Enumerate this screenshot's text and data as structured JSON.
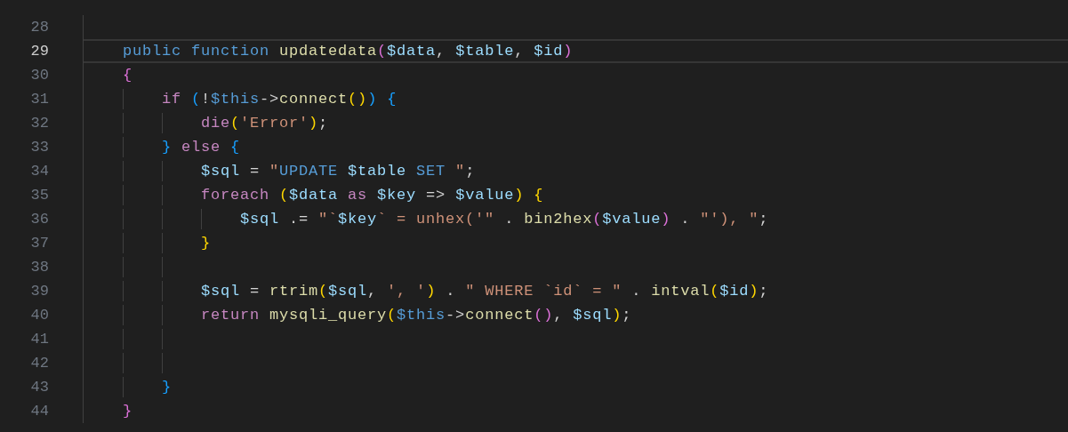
{
  "editor": {
    "lines": [
      {
        "number": "28",
        "selected": false
      },
      {
        "number": "29",
        "selected": true,
        "tokens": [
          {
            "text": "    public ",
            "kind": "kw"
          },
          {
            "text": "function ",
            "kind": "kw"
          },
          {
            "text": "updatedata",
            "kind": "fn"
          },
          {
            "text": "(",
            "kind": "b2"
          },
          {
            "text": "$data",
            "kind": "var"
          },
          {
            "text": ", ",
            "kind": "op"
          },
          {
            "text": "$table",
            "kind": "var"
          },
          {
            "text": ", ",
            "kind": "op"
          },
          {
            "text": "$id",
            "kind": "var"
          },
          {
            "text": ")",
            "kind": "b2"
          }
        ]
      },
      {
        "number": "30",
        "selected": false,
        "tokens": [
          {
            "text": "    {",
            "kind": "b2"
          }
        ]
      },
      {
        "number": "31",
        "selected": false,
        "tokens": [
          {
            "text": "        if ",
            "kind": "ctl"
          },
          {
            "text": "(",
            "kind": "b3"
          },
          {
            "text": "!",
            "kind": "op"
          },
          {
            "text": "$this",
            "kind": "this"
          },
          {
            "text": "->",
            "kind": "op"
          },
          {
            "text": "connect",
            "kind": "fn"
          },
          {
            "text": "()",
            "kind": "b1"
          },
          {
            "text": ") {",
            "kind": "b3"
          }
        ]
      },
      {
        "number": "32",
        "selected": false,
        "tokens": [
          {
            "text": "            die",
            "kind": "ctl"
          },
          {
            "text": "(",
            "kind": "b1"
          },
          {
            "text": "'Error'",
            "kind": "str"
          },
          {
            "text": ")",
            "kind": "b1"
          },
          {
            "text": ";",
            "kind": "op"
          }
        ]
      },
      {
        "number": "33",
        "selected": false,
        "tokens": [
          {
            "text": "        } ",
            "kind": "b3"
          },
          {
            "text": "else ",
            "kind": "ctl"
          },
          {
            "text": "{",
            "kind": "b3"
          }
        ]
      },
      {
        "number": "34",
        "selected": false,
        "tokens": [
          {
            "text": "            $sql",
            "kind": "var"
          },
          {
            "text": " = ",
            "kind": "op"
          },
          {
            "text": "\"",
            "kind": "str"
          },
          {
            "text": "UPDATE ",
            "kind": "sqlkw"
          },
          {
            "text": "$table",
            "kind": "var"
          },
          {
            "text": " SET ",
            "kind": "sqlkw"
          },
          {
            "text": "\"",
            "kind": "str"
          },
          {
            "text": ";",
            "kind": "op"
          }
        ]
      },
      {
        "number": "35",
        "selected": false,
        "tokens": [
          {
            "text": "            foreach ",
            "kind": "ctl"
          },
          {
            "text": "(",
            "kind": "b1"
          },
          {
            "text": "$data",
            "kind": "var"
          },
          {
            "text": " as ",
            "kind": "ctl"
          },
          {
            "text": "$key",
            "kind": "var"
          },
          {
            "text": " => ",
            "kind": "op"
          },
          {
            "text": "$value",
            "kind": "var"
          },
          {
            "text": ") {",
            "kind": "b1"
          }
        ]
      },
      {
        "number": "36",
        "selected": false,
        "tokens": [
          {
            "text": "                $sql",
            "kind": "var"
          },
          {
            "text": " .= ",
            "kind": "op"
          },
          {
            "text": "\"`",
            "kind": "str"
          },
          {
            "text": "$key",
            "kind": "var"
          },
          {
            "text": "` = unhex('\"",
            "kind": "str"
          },
          {
            "text": " . ",
            "kind": "op"
          },
          {
            "text": "bin2hex",
            "kind": "fn"
          },
          {
            "text": "(",
            "kind": "b2"
          },
          {
            "text": "$value",
            "kind": "var"
          },
          {
            "text": ")",
            "kind": "b2"
          },
          {
            "text": " . ",
            "kind": "op"
          },
          {
            "text": "\"'), \"",
            "kind": "str"
          },
          {
            "text": ";",
            "kind": "op"
          }
        ]
      },
      {
        "number": "37",
        "selected": false,
        "tokens": [
          {
            "text": "            }",
            "kind": "b1"
          }
        ]
      },
      {
        "number": "38",
        "selected": false
      },
      {
        "number": "39",
        "selected": false,
        "tokens": [
          {
            "text": "            $sql",
            "kind": "var"
          },
          {
            "text": " = ",
            "kind": "op"
          },
          {
            "text": "rtrim",
            "kind": "fn"
          },
          {
            "text": "(",
            "kind": "b1"
          },
          {
            "text": "$sql",
            "kind": "var"
          },
          {
            "text": ", ",
            "kind": "op"
          },
          {
            "text": "', '",
            "kind": "str"
          },
          {
            "text": ")",
            "kind": "b1"
          },
          {
            "text": " . ",
            "kind": "op"
          },
          {
            "text": "\" WHERE `id` = \"",
            "kind": "str"
          },
          {
            "text": " . ",
            "kind": "op"
          },
          {
            "text": "intval",
            "kind": "fn"
          },
          {
            "text": "(",
            "kind": "b1"
          },
          {
            "text": "$id",
            "kind": "var"
          },
          {
            "text": ")",
            "kind": "b1"
          },
          {
            "text": ";",
            "kind": "op"
          }
        ]
      },
      {
        "number": "40",
        "selected": false,
        "tokens": [
          {
            "text": "            return ",
            "kind": "ctl"
          },
          {
            "text": "mysqli_query",
            "kind": "fn"
          },
          {
            "text": "(",
            "kind": "b1"
          },
          {
            "text": "$this",
            "kind": "this"
          },
          {
            "text": "->",
            "kind": "op"
          },
          {
            "text": "connect",
            "kind": "fn"
          },
          {
            "text": "()",
            "kind": "b2"
          },
          {
            "text": ", ",
            "kind": "op"
          },
          {
            "text": "$sql",
            "kind": "var"
          },
          {
            "text": ")",
            "kind": "b1"
          },
          {
            "text": ";",
            "kind": "op"
          }
        ]
      },
      {
        "number": "41",
        "selected": false
      },
      {
        "number": "42",
        "selected": false
      },
      {
        "number": "43",
        "selected": false,
        "tokens": [
          {
            "text": "        }",
            "kind": "b3"
          }
        ]
      },
      {
        "number": "44",
        "selected": false,
        "tokens": [
          {
            "text": "    }",
            "kind": "b2"
          }
        ]
      }
    ]
  }
}
